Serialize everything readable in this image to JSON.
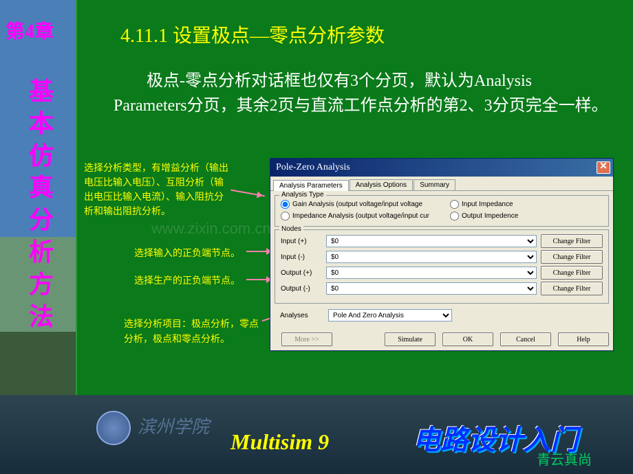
{
  "chapter": "第4章",
  "vertical_title": "基本仿真分析方法",
  "section_title": "4.11.1 设置极点—零点分析参数",
  "body_text": "极点-零点分析对话框也仅有3个分页，默认为Analysis Parameters分页，其余2页与直流工作点分析的第2、3分页完全一样。",
  "annotations": {
    "a1": "选择分析类型，有增益分析（输出电压比输入电压）、互阻分析（输出电压比输入电流）、输入阻抗分析和输出阻抗分析。",
    "a2": "选择输入的正负端节点。",
    "a3": "选择生产的正负端节点。",
    "a4": "选择分析项目：极点分析，零点分析，极点和零点分析。"
  },
  "watermark": "www.zixin.com.cn",
  "dialog": {
    "title": "Pole-Zero Analysis",
    "tabs": [
      "Analysis Parameters",
      "Analysis Options",
      "Summary"
    ],
    "analysis_type_legend": "Analysis Type",
    "radios": {
      "gain": "Gain Analysis (output voltage/input voltage",
      "impedance": "Impedance Analysis (output voltage/input cur",
      "input_imp": "Input Impedance",
      "output_imp": "Output Impedence"
    },
    "nodes_legend": "Nodes",
    "nodes": {
      "input_p": "Input (+)",
      "input_n": "Input (-)",
      "output_p": "Output (+)",
      "output_n": "Output (-)",
      "value": "$0",
      "change_filter": "Change Filter"
    },
    "analyses_label": "Analyses",
    "analyses_value": "Pole And Zero Analysis",
    "buttons": {
      "more": "More >>",
      "simulate": "Simulate",
      "ok": "OK",
      "cancel": "Cancel",
      "help": "Help"
    }
  },
  "footer": {
    "uni": "滨州学院",
    "multisim": "Multisim 9",
    "design": "电路设计入门",
    "sub": "青云真尚"
  }
}
